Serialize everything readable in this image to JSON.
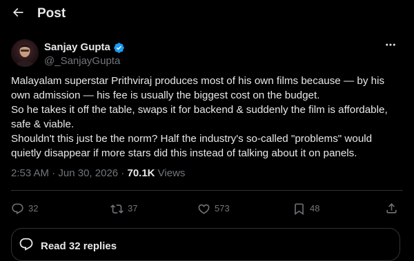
{
  "header": {
    "title": "Post",
    "back_icon": "arrow-left-icon"
  },
  "author": {
    "name": "Sanjay Gupta",
    "handle": "@_SanjayGupta",
    "verified": true,
    "verified_color": "#1d9bf0"
  },
  "tweet": {
    "lines": [
      "Malayalam superstar Prithviraj produces most of his own films because — by his",
      "own admission — his fee is usually the biggest cost on the budget.",
      "So he takes it off the table, swaps it for backend & suddenly the film is affordable,",
      "safe & viable.",
      "Shouldn't this just be the norm? Half the industry's so-called \"problems\" would",
      "quietly disappear if more stars did this instead of talking about it on panels."
    ]
  },
  "meta": {
    "time": "2:53 AM",
    "separator": " · ",
    "date": "Jun 30, 2026",
    "views_count": "70.1K",
    "views_label": " Views"
  },
  "actions": {
    "replies": "32",
    "reposts": "37",
    "likes": "573",
    "bookmarks": "48"
  },
  "replies_button": {
    "label": "Read 32 replies"
  },
  "colors": {
    "background": "#000000",
    "text": "#e7e9ea",
    "secondary": "#71767b",
    "border": "#2f3336",
    "accent": "#1d9bf0"
  }
}
